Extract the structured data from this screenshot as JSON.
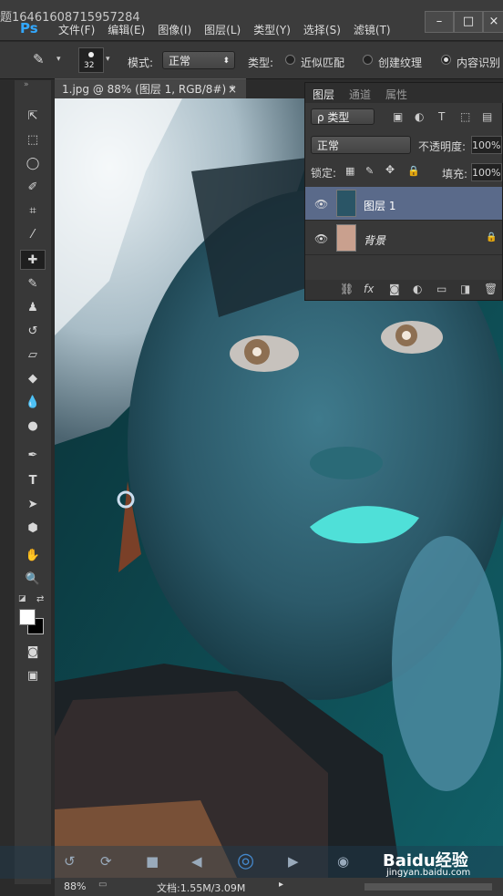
{
  "title_overlay": "题16461608715957284",
  "app_logo": "Ps",
  "menu": [
    "文件(F)",
    "编辑(E)",
    "图像(I)",
    "图层(L)",
    "类型(Y)",
    "选择(S)",
    "滤镜(T)"
  ],
  "window_buttons": [
    "–",
    "□",
    "×"
  ],
  "options": {
    "brush_size": "32",
    "mode_label": "模式:",
    "mode_value": "正常",
    "type_label": "类型:",
    "radio_items": [
      "近似匹配",
      "创建纹理",
      "内容识别"
    ]
  },
  "document_tab": {
    "title": "1.jpg @ 88% (图层 1, RGB/8#) *",
    "close": "×"
  },
  "layers_panel": {
    "tabs": [
      "图层",
      "通道",
      "属性"
    ],
    "filter_label": "ρ 类型",
    "blend_mode": "正常",
    "opacity_label": "不透明度:",
    "opacity_value": "100%",
    "lock_label": "锁定:",
    "fill_label": "填充:",
    "fill_value": "100%",
    "layers": [
      {
        "name": "图层 1",
        "selected": true
      },
      {
        "name": "背景",
        "selected": false
      }
    ],
    "footer_icons": [
      "link-icon",
      "fx-icon",
      "mask-icon",
      "adjustment-icon",
      "folder-icon",
      "new-layer-icon",
      "trash-icon"
    ]
  },
  "status": {
    "zoom": "88%",
    "doc_info": "文档:1.55M/3.09M"
  },
  "watermark": {
    "brand": "Baidu经验",
    "url": "jingyan.baidu.com"
  },
  "colors": {
    "canvas_dark": "#0c3a40",
    "skin": "#3d6e80",
    "accent_blue": "#32a8ff",
    "lips": "#4fe0d8"
  }
}
